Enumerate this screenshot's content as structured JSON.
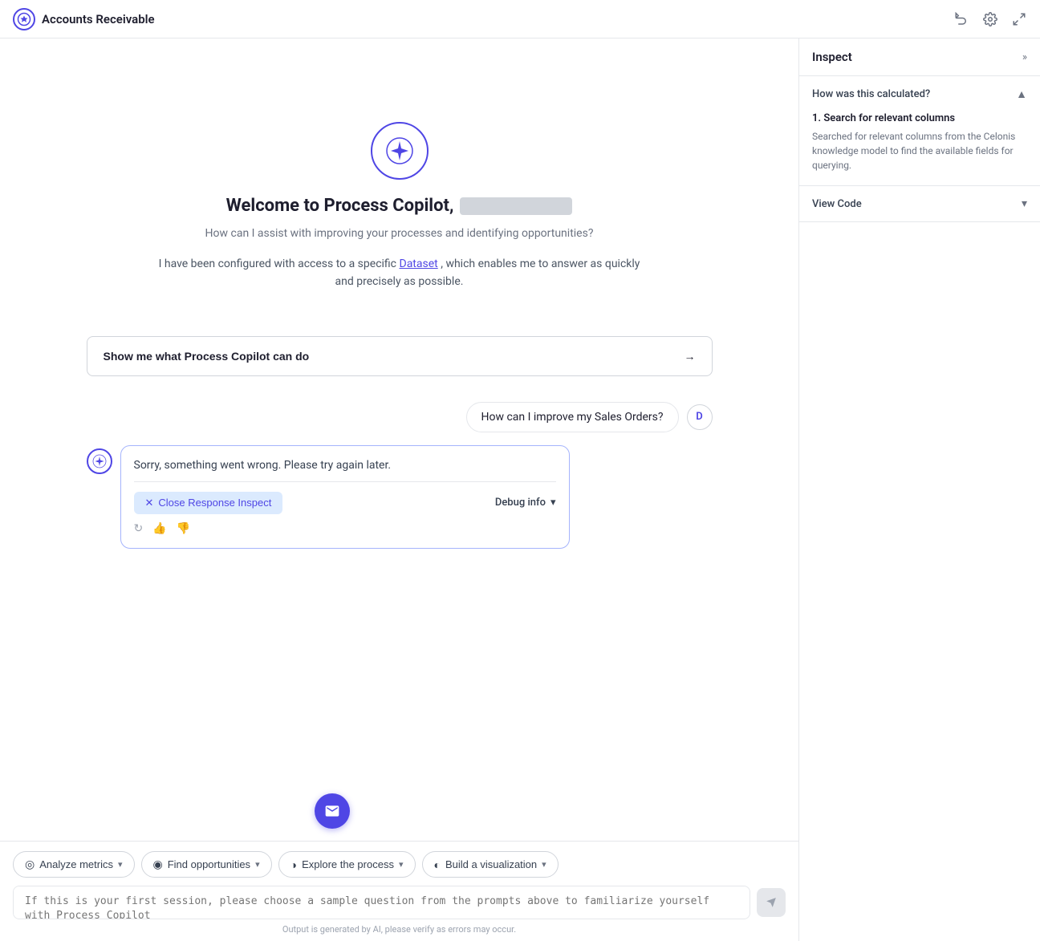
{
  "header": {
    "title": "Accounts Receivable",
    "logo_icon": "◈",
    "undo_icon": "↺",
    "settings_icon": "⚙",
    "expand_icon": "⤢"
  },
  "right_panel": {
    "title": "Inspect",
    "expand_label": "»",
    "how_calculated": {
      "label": "How was this calculated?",
      "steps": [
        {
          "number": "1.",
          "title": "Search for relevant columns",
          "description": "Searched for relevant columns from the Celonis knowledge model to find the available fields for querying."
        }
      ]
    },
    "view_code": {
      "label": "View Code"
    }
  },
  "welcome": {
    "title_prefix": "Welcome to Process Copilot,",
    "subtitle": "How can I assist with improving your processes and identifying opportunities?",
    "dataset_text_1": "I have been configured with access to a specific",
    "dataset_link": "Dataset",
    "dataset_text_2": ", which enables me to answer as quickly and precisely as possible."
  },
  "show_me_btn": {
    "label": "Show me what Process Copilot can do",
    "arrow": "→"
  },
  "messages": [
    {
      "type": "user",
      "text": "How can I improve my Sales Orders?",
      "avatar": "D"
    },
    {
      "type": "bot",
      "error_text": "Sorry, something went wrong. Please try again later.",
      "debug_label": "Debug info",
      "close_label": "Close Response Inspect"
    }
  ],
  "chips": [
    {
      "icon": "◎",
      "label": "Analyze metrics",
      "has_arrow": true
    },
    {
      "icon": "◉",
      "label": "Find opportunities",
      "has_arrow": true
    },
    {
      "icon": "◑",
      "label": "Explore the process",
      "has_arrow": true
    },
    {
      "icon": "◐",
      "label": "Build a visualization",
      "has_arrow": true
    }
  ],
  "input": {
    "placeholder": "If this is your first session, please choose a sample question from the prompts above to familiarize yourself with Process Copilot",
    "send_icon": "▶"
  },
  "disclaimer": "Output is generated by AI, please verify as errors may occur.",
  "fab_icon": "✉"
}
